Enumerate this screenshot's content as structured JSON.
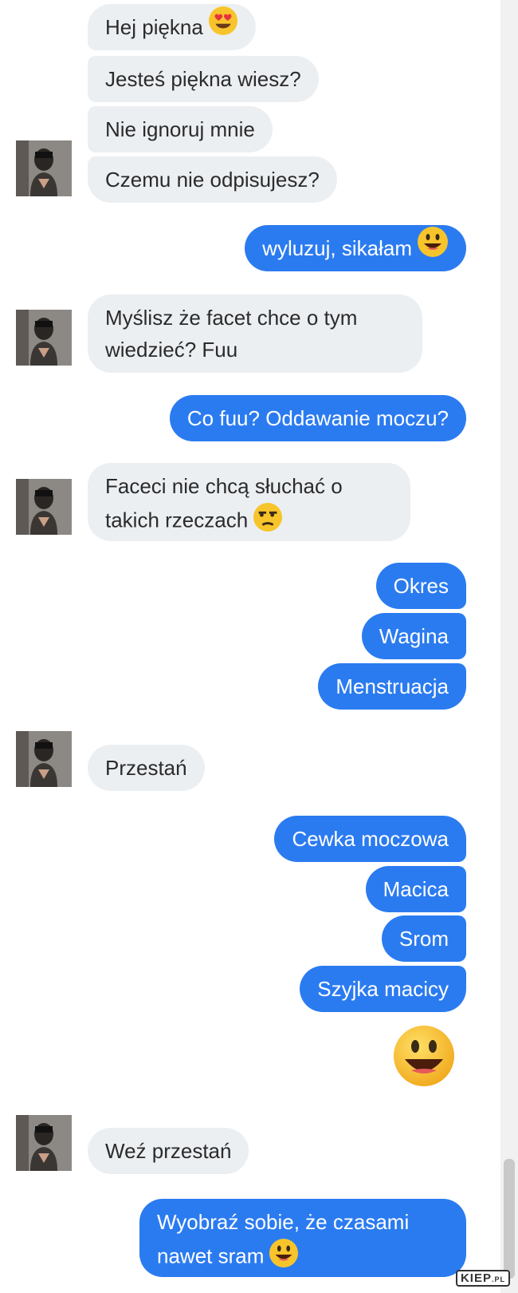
{
  "messages": {
    "m1": "Hej piękna",
    "m2": "Jesteś piękna wiesz?",
    "m3": "Nie ignoruj mnie",
    "m4": "Czemu nie odpisujesz?",
    "m5": "wyluzuj, sikałam",
    "m6": "Myślisz że facet chce o tym wiedzieć? Fuu",
    "m7": "Co fuu? Oddawanie moczu?",
    "m8": "Faceci nie chcą słuchać o takich rzeczach",
    "m9": "Okres",
    "m10": "Wagina",
    "m11": "Menstruacja",
    "m12": "Przestań",
    "m13": "Cewka moczowa",
    "m14": "Macica",
    "m15": "Srom",
    "m16": "Szyjka macicy",
    "m17": "Weź przestań",
    "m18": "Wyobraź sobie, że czasami nawet sram"
  },
  "icons": {
    "heart_eyes": "heart-eyes-emoji",
    "grin": "grinning-emoji",
    "unamused": "unamused-emoji",
    "big_grin": "big-grinning-emoji"
  },
  "colors": {
    "outgoing": "#2b7bf0",
    "incoming": "#eceff2",
    "emoji_yellow": "#f7c52b"
  },
  "watermark": {
    "main": "KIEP",
    "suffix": ".PL"
  }
}
